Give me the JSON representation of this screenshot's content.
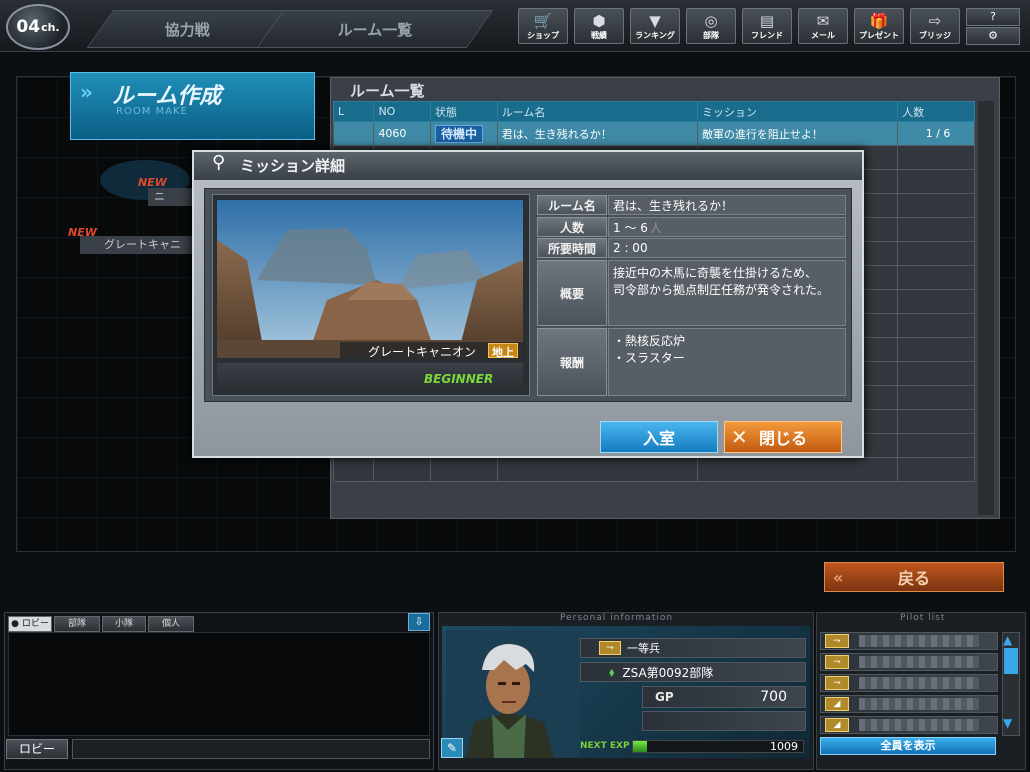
{
  "channel": {
    "number": "04",
    "suffix": "ch."
  },
  "top_tabs": [
    "協力戦",
    "ルーム一覧"
  ],
  "nav_buttons": [
    {
      "label": "ショップ",
      "icon": "cart-icon",
      "glyph": "🛒"
    },
    {
      "label": "戦績",
      "icon": "medal-icon",
      "glyph": "⬢"
    },
    {
      "label": "ランキング",
      "icon": "ranking-icon",
      "glyph": "▼"
    },
    {
      "label": "部隊",
      "icon": "unit-icon",
      "glyph": "◎"
    },
    {
      "label": "フレンド",
      "icon": "friend-icon",
      "glyph": "▤"
    },
    {
      "label": "メール",
      "icon": "mail-icon",
      "glyph": "✉"
    },
    {
      "label": "プレゼント",
      "icon": "gift-icon",
      "glyph": "🎁"
    },
    {
      "label": "ブリッジ",
      "icon": "bridge-icon",
      "glyph": "⇨"
    }
  ],
  "help_label": "?",
  "settings_label": "⚙",
  "room_make": {
    "title": "ルーム作成",
    "subtitle": "ROOM MAKE",
    "chevron": "»"
  },
  "side_list": [
    {
      "new": "NEW",
      "label": "ニ"
    },
    {
      "new": "NEW",
      "label": "グレートキャニ"
    }
  ],
  "room_list": {
    "title": "ルーム一覧",
    "columns": [
      "L",
      "NO",
      "状態",
      "ルーム名",
      "ミッション",
      "人数"
    ],
    "rows": [
      {
        "l": "",
        "no": "4060",
        "status": "待機中",
        "room_name": "君は、生き残れるか！",
        "mission": "敵軍の進行を阻止せよ！",
        "count": "1 / 6"
      }
    ]
  },
  "back_button": "戻る",
  "modal": {
    "title": "ミッション詳細",
    "map_name": "グレートキャニオン",
    "map_type": "地上",
    "difficulty": "BEGINNER",
    "room_name_label": "ルーム名",
    "room_name": "君は、生き残れるか！",
    "count_label": "人数",
    "count": "1 ～ 6",
    "count_unit": "人",
    "time_label": "所要時間",
    "time": "2 : 00",
    "summary_label": "概要",
    "summary": "接近中の木馬に奇襲を仕掛けるため、\n司令部から拠点制圧任務が発令された。",
    "reward_label": "報酬",
    "rewards": "・熱核反応炉\n・スラスター",
    "enter_button": "入室",
    "close_button": "閉じる"
  },
  "chat": {
    "tabs": [
      "● ロビー",
      "部隊",
      "小隊",
      "個人"
    ],
    "channel_button": "ロビー",
    "input_value": ""
  },
  "personal": {
    "header": "Personal information",
    "rank": "一等兵",
    "unit": "ZSA第0092部隊",
    "gp_label": "GP",
    "gp": "700",
    "exp_label": "NEXT EXP",
    "exp": "1009",
    "exp_progress": 0.08
  },
  "pilot_list": {
    "header": "Pilot list",
    "show_all": "全員を表示"
  },
  "colors": {
    "accent_blue": "#1a6c8c",
    "enter_blue": "#137cc0",
    "close_orange": "#c25a10",
    "difficulty_green": "#7bd83a",
    "new_red": "#e04a2a"
  }
}
